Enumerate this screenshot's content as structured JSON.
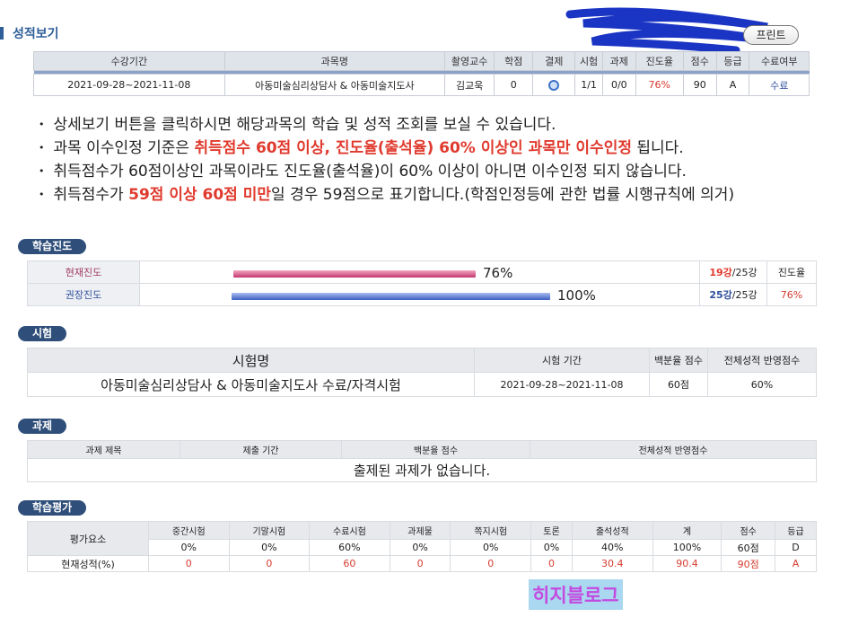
{
  "header": {
    "title": "성적보기",
    "print_label": "프린트"
  },
  "summary": {
    "headers": [
      "수강기간",
      "과목명",
      "촬영교수",
      "학점",
      "결제",
      "시험",
      "과제",
      "진도율",
      "점수",
      "등급",
      "수료여부"
    ],
    "row": {
      "period": "2021-09-28~2021-11-08",
      "course": "아동미술심리상담사 & 아동미술지도사",
      "professor": "김교욱",
      "credit": "0",
      "exam": "1/1",
      "assignment": "0/0",
      "progress": "76%",
      "score": "90",
      "grade": "A",
      "completion": "수료"
    }
  },
  "notes": {
    "n1": "상세보기 버튼을 클릭하시면 해당과목의 학습 및 성적 조회를 보실 수 있습니다.",
    "n2_a": "과목 이수인정 기준은 ",
    "n2_b": "취득점수 60점 이상, 진도율(출석율) 60% 이상인 과목만 이수인정",
    "n2_c": " 됩니다.",
    "n3": "취득점수가 60점이상인 과목이라도 진도율(출석율)이 60% 이상이 아니면 이수인정 되지 않습니다.",
    "n4_a": "취득점수가 ",
    "n4_b": "59점 이상 60점 미만",
    "n4_c": "일 경우 59점으로 표기합니다.(학점인정등에 관한 법률 시행규칙에 의거)"
  },
  "sections": {
    "progress": "학습진도",
    "exam": "시험",
    "assignment": "과제",
    "evaluation": "학습평가"
  },
  "progress": {
    "current": {
      "label": "현재진도",
      "percent": 76,
      "pct_text": "76%",
      "done": "19강",
      "total": "/25강"
    },
    "recommended": {
      "label": "권장진도",
      "percent": 100,
      "pct_text": "100%",
      "done": "25강",
      "total": "/25강"
    },
    "rate_label": "진도율",
    "rate_value": "76%"
  },
  "exam": {
    "headers": [
      "시험명",
      "시험 기간",
      "백분율 점수",
      "전체성적 반영점수"
    ],
    "row": {
      "name": "아동미술심리상담사 & 아동미술지도사 수료/자격시험",
      "period": "2021-09-28~2021-11-08",
      "score": "60점",
      "weight": "60%"
    }
  },
  "assignment": {
    "headers": [
      "과제 제목",
      "제출 기간",
      "백분율 점수",
      "전체성적 반영점수"
    ],
    "empty": "출제된 과제가 없습니다."
  },
  "evaluation": {
    "row_header": "평가요소",
    "current_label": "현재성적(%)",
    "headers": [
      "중간시험",
      "기말시험",
      "수료시험",
      "과제물",
      "쪽지시험",
      "토론",
      "출석성적",
      "계",
      "점수",
      "등급"
    ],
    "weights": [
      "0%",
      "0%",
      "60%",
      "0%",
      "0%",
      "0%",
      "40%",
      "100%",
      "60점",
      "D"
    ],
    "current": [
      "0",
      "0",
      "60",
      "0",
      "0",
      "0",
      "30.4",
      "90.4",
      "90점",
      "A"
    ]
  },
  "watermark": "히지블로그",
  "colors": {
    "accent": "#2f4f7a",
    "red": "#e03a2e",
    "title_blue": "#2f5f98"
  }
}
